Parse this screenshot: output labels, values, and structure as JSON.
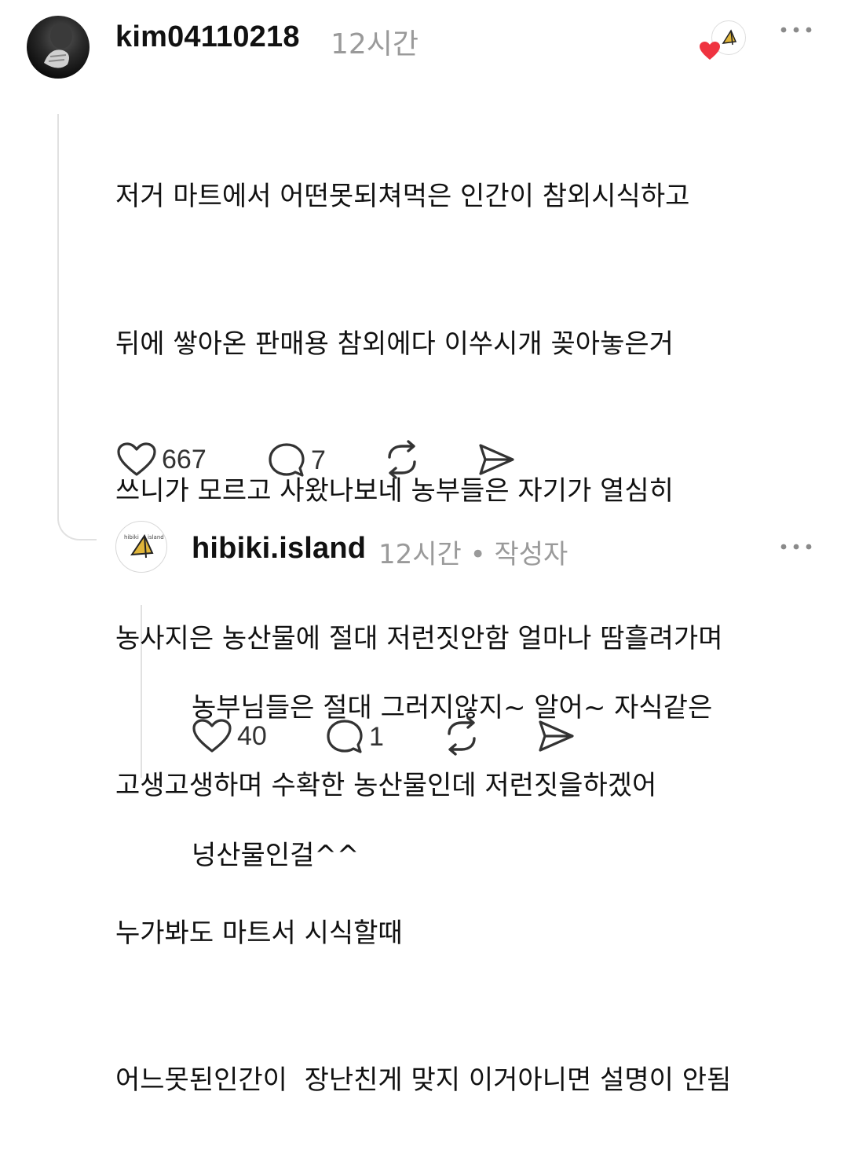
{
  "comment": {
    "username": "kim04110218",
    "time": "12시간",
    "body_lines": [
      "저거 마트에서 어떤못되쳐먹은 인간이 참외시식하고",
      "뒤에 쌓아온 판매용 참외에다 이쑤시개 꽂아놓은거",
      "쓰니가 모르고 사왔나보네 농부들은 자기가 열심히",
      "농사지은 농산물에 절대 저런짓안함 얼마나 땀흘려가며",
      "고생고생하며 수확한 농산물인데 저런짓을하겠어",
      "누가봐도 마트서 시식할때",
      "어느못된인간이  장난친게 맞지 이거아니면 설명이 안됨"
    ],
    "likes": "667",
    "replies": "7",
    "more_icon": "ellipsis-icon",
    "liked_by_author_icon": "author-heart-icon"
  },
  "reply": {
    "username": "hibiki.island",
    "time": "12시간 • 작성자",
    "body_lines": [
      "농부님들은 절대 그러지않지~ 알어~ 자식같은",
      "넝산물인걸^^"
    ],
    "likes": "40",
    "replies": "1"
  },
  "colors": {
    "heart_red": "#ef3340",
    "line_gray": "#e1e1e1",
    "meta_gray": "#9a9a9a"
  }
}
